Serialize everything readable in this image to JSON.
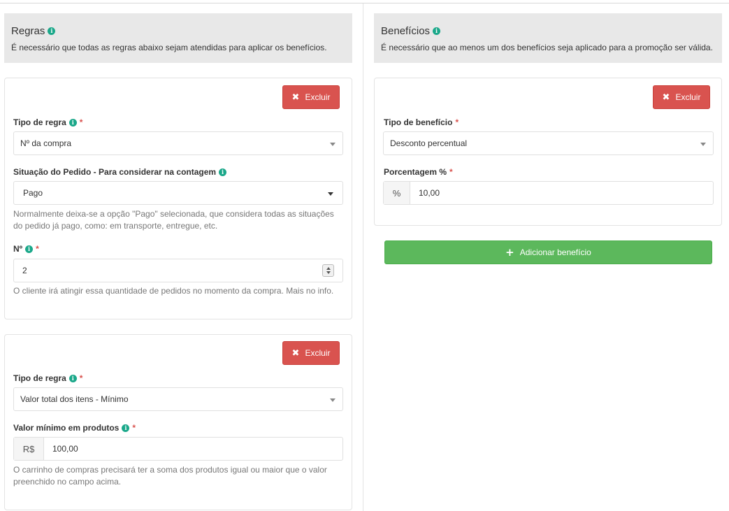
{
  "rules_header": {
    "title": "Regras",
    "description": "É necessário que todas as regras abaixo sejam atendidas para aplicar os benefícios."
  },
  "benefits_header": {
    "title": "Benefícios",
    "description": "É necessário que ao menos um dos benefícios seja aplicado para a promoção ser válida."
  },
  "rule1": {
    "delete_label": "Excluir",
    "tipo_label": "Tipo de regra",
    "tipo_value": "Nº da compra",
    "situacao_label": "Situação do Pedido - Para considerar na contagem",
    "situacao_value": "Pago",
    "situacao_help_1": "Normalmente deixa-se a opção \"Pago\" selecionada, que considera todas as situações",
    "situacao_help_2": "do pedido já pago, como: em transporte, entregue, etc.",
    "numero_label": "Nº",
    "numero_value": "2",
    "numero_help": "O cliente irá atingir essa quantidade de pedidos no momento da compra. Mais no info."
  },
  "rule2": {
    "delete_label": "Excluir",
    "tipo_label": "Tipo de regra",
    "tipo_value": "Valor total dos itens - Mínimo",
    "valor_label": "Valor mínimo em produtos",
    "valor_prefix": "R$",
    "valor_value": "100,00",
    "valor_help_1": "O carrinho de compras precisará ter a soma dos produtos igual ou maior que o valor",
    "valor_help_2": "preenchido no campo acima."
  },
  "benefit1": {
    "delete_label": "Excluir",
    "tipo_label": "Tipo de benefício",
    "tipo_value": "Desconto percentual",
    "porcentagem_label": "Porcentagem %",
    "porcentagem_prefix": "%",
    "porcentagem_value": "10,00"
  },
  "add_benefit_label": "Adicionar benefício",
  "icons": {
    "info": "i",
    "required": "*",
    "delete": "✖",
    "add": "+"
  },
  "colors": {
    "danger": "#d9534f",
    "success": "#5cb85c",
    "info": "#1ba88a"
  }
}
